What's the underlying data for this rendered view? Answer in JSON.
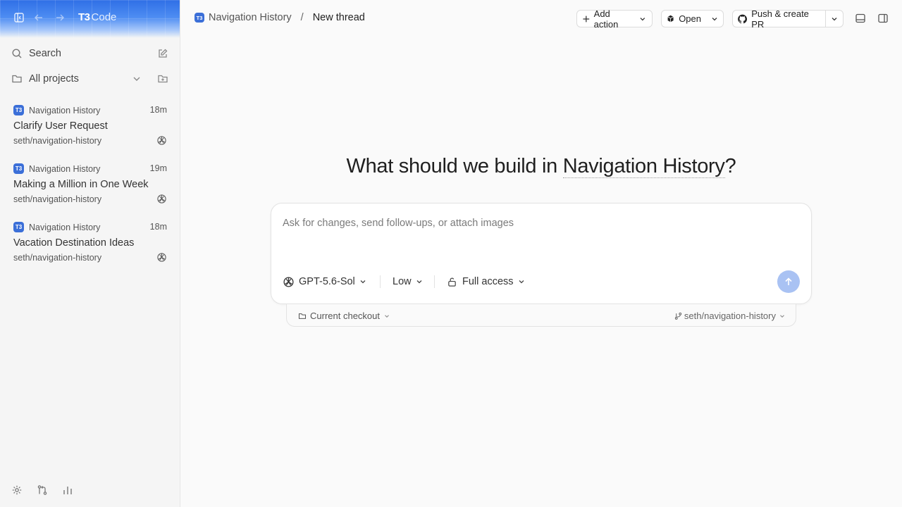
{
  "app": {
    "brand_t3": "T3",
    "brand_code": "Code"
  },
  "sidebar": {
    "search_label": "Search",
    "projects_label": "All projects",
    "threads": [
      {
        "project": "Navigation History",
        "age": "18m",
        "title": "Clarify User Request",
        "branch": "seth/navigation-history"
      },
      {
        "project": "Navigation History",
        "age": "19m",
        "title": "Making a Million in One Week",
        "branch": "seth/navigation-history"
      },
      {
        "project": "Navigation History",
        "age": "18m",
        "title": "Vacation Destination Ideas",
        "branch": "seth/navigation-history"
      }
    ],
    "badge_text": "T3"
  },
  "header": {
    "project": "Navigation History",
    "separator": "/",
    "current": "New thread",
    "add_action_label": "Add action",
    "open_label": "Open",
    "push_label": "Push & create PR"
  },
  "main": {
    "heading_prefix": "What should we build in ",
    "heading_project": "Navigation History",
    "heading_suffix": "?",
    "composer": {
      "placeholder": "Ask for changes, send follow-ups, or attach images",
      "model": "GPT-5.6-Sol",
      "effort": "Low",
      "access": "Full access"
    },
    "checkout_label": "Current checkout",
    "branch": "seth/navigation-history"
  },
  "colors": {
    "accent": "#3b6fd8",
    "send_disabled": "#a9c2f3",
    "brand_gradient_top": "#2f6fe6"
  }
}
